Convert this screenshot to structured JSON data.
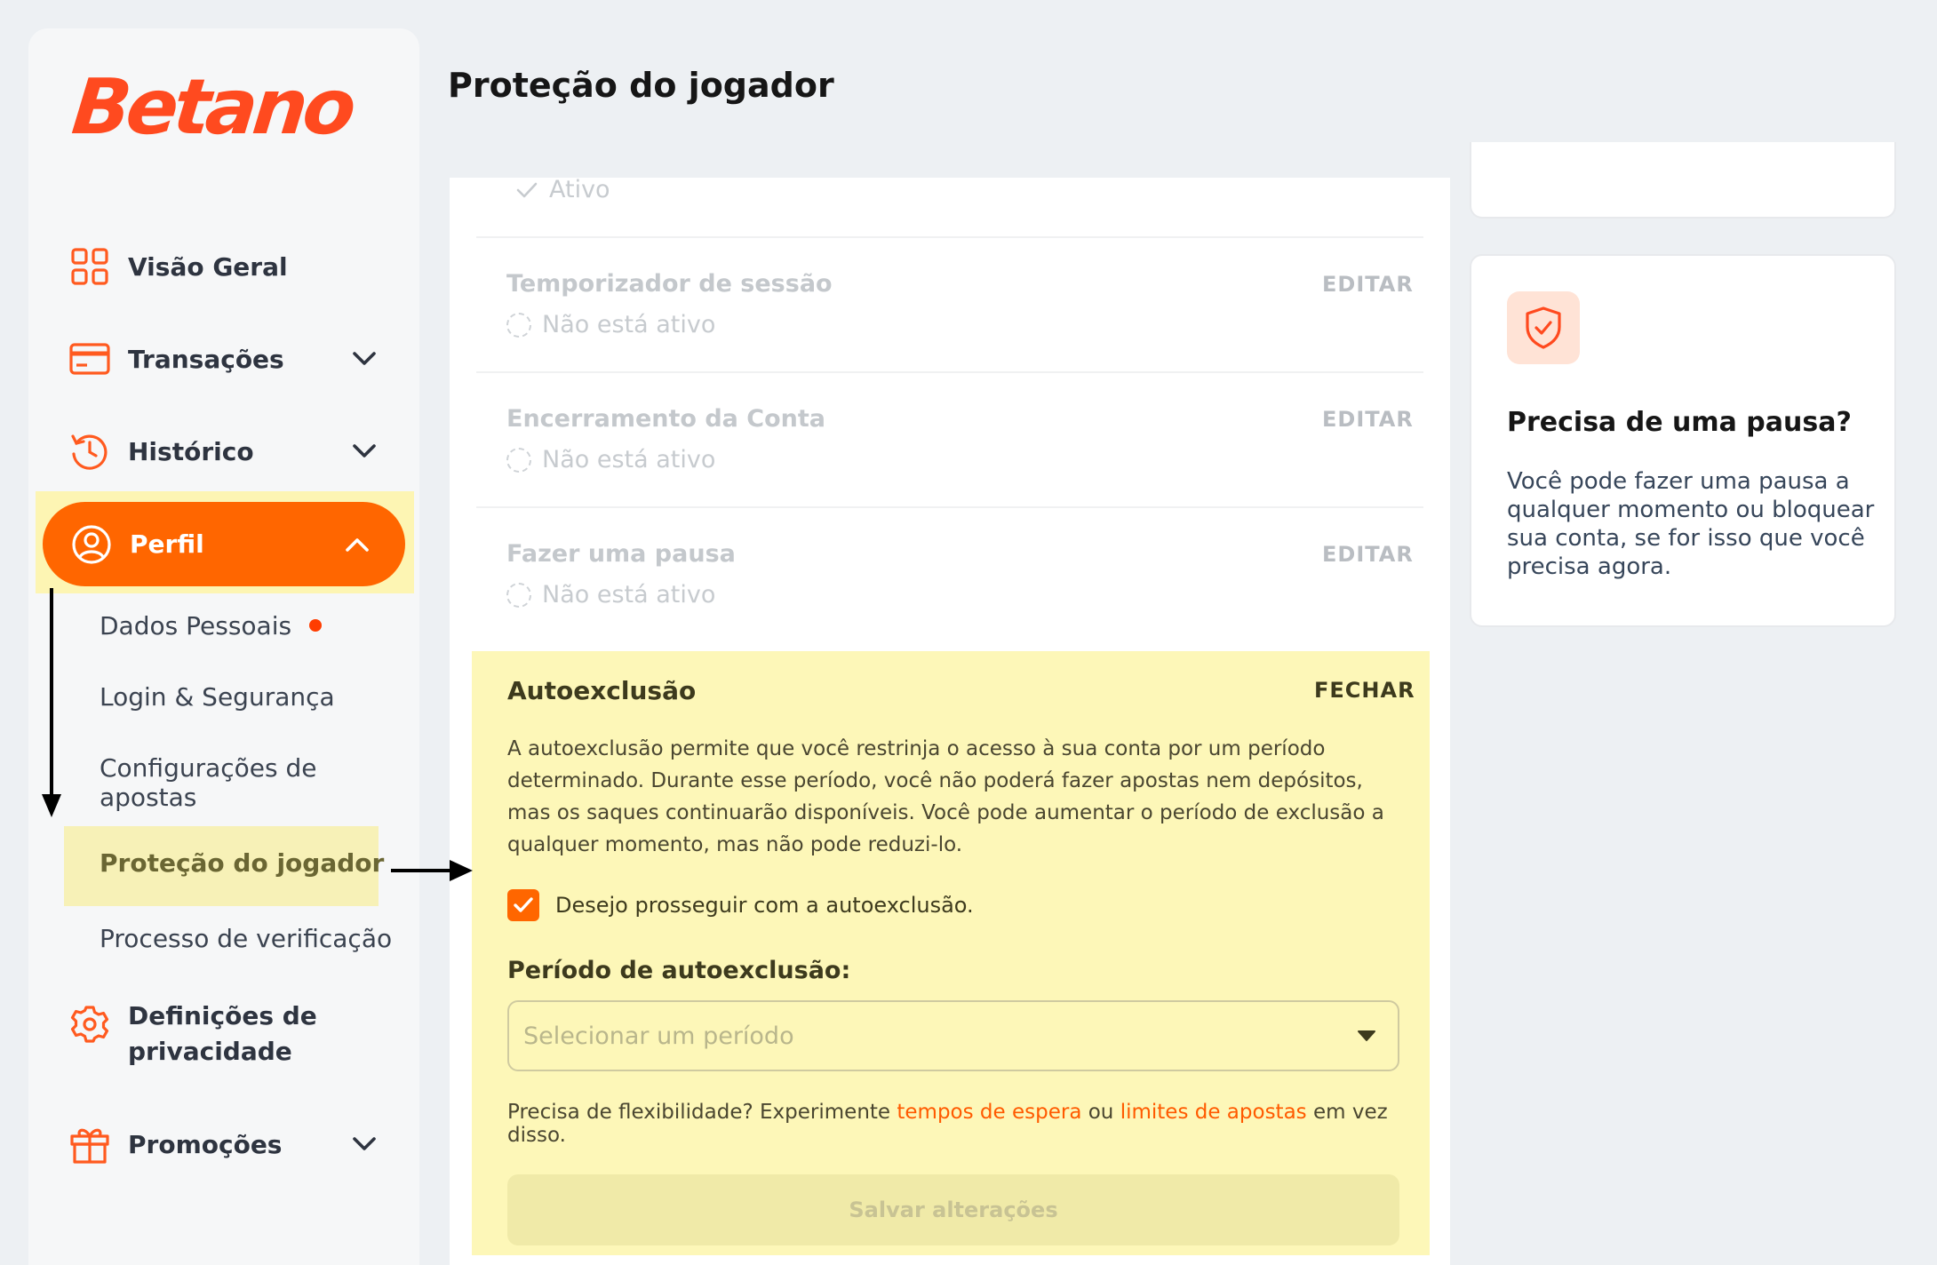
{
  "brand": {
    "logo_text": "Betano",
    "accent": "#ff6600",
    "logo_color": "#ff4a1f"
  },
  "header": {
    "title": "Proteção do jogador"
  },
  "sidebar": {
    "items": [
      {
        "label": "Visão Geral",
        "icon": "grid-icon"
      },
      {
        "label": "Transações",
        "icon": "credit-card-icon"
      },
      {
        "label": "Histórico",
        "icon": "history-icon"
      },
      {
        "label": "Perfil",
        "icon": "user-circle-icon"
      },
      {
        "label": "Definições de privacidade",
        "icon": "gear-icon"
      },
      {
        "label": "Promoções",
        "icon": "gift-icon"
      }
    ],
    "profile_sub": [
      {
        "label": "Dados Pessoais"
      },
      {
        "label": "Login & Segurança"
      },
      {
        "label": "Configurações de apostas"
      },
      {
        "label": "Proteção do jogador"
      },
      {
        "label": "Processo de verificação"
      }
    ]
  },
  "limits": {
    "top_status": "Ativo",
    "edit_label": "EDITAR",
    "rows": [
      {
        "title": "Temporizador de sessão",
        "status": "Não está ativo"
      },
      {
        "title": "Encerramento da Conta",
        "status": "Não está ativo"
      },
      {
        "title": "Fazer uma pausa",
        "status": "Não está ativo"
      }
    ]
  },
  "self_exclusion": {
    "title": "Autoexclusão",
    "close_label": "FECHAR",
    "description": "A autoexclusão permite que você restrinja o acesso à sua conta por um período determinado. Durante esse período, você não poderá fazer apostas nem depósitos, mas os saques continuarão disponíveis. Você pode aumentar o período de exclusão a qualquer momento, mas não pode reduzi-lo.",
    "checkbox_label": "Desejo prosseguir com a autoexclusão.",
    "checkbox_checked": true,
    "period_label": "Período de autoexclusão:",
    "period_placeholder": "Selecionar um período",
    "flex_prefix": "Precisa de flexibilidade? Experimente",
    "flex_link1": "tempos de espera",
    "flex_middle": "ou",
    "flex_link2": "limites de apostas",
    "flex_suffix": "em vez disso.",
    "save_label": "Salvar alterações"
  },
  "pause_card": {
    "title": "Precisa de uma pausa?",
    "text": "Você pode fazer uma pausa a qualquer momento ou bloquear sua conta, se for isso que você precisa agora."
  }
}
